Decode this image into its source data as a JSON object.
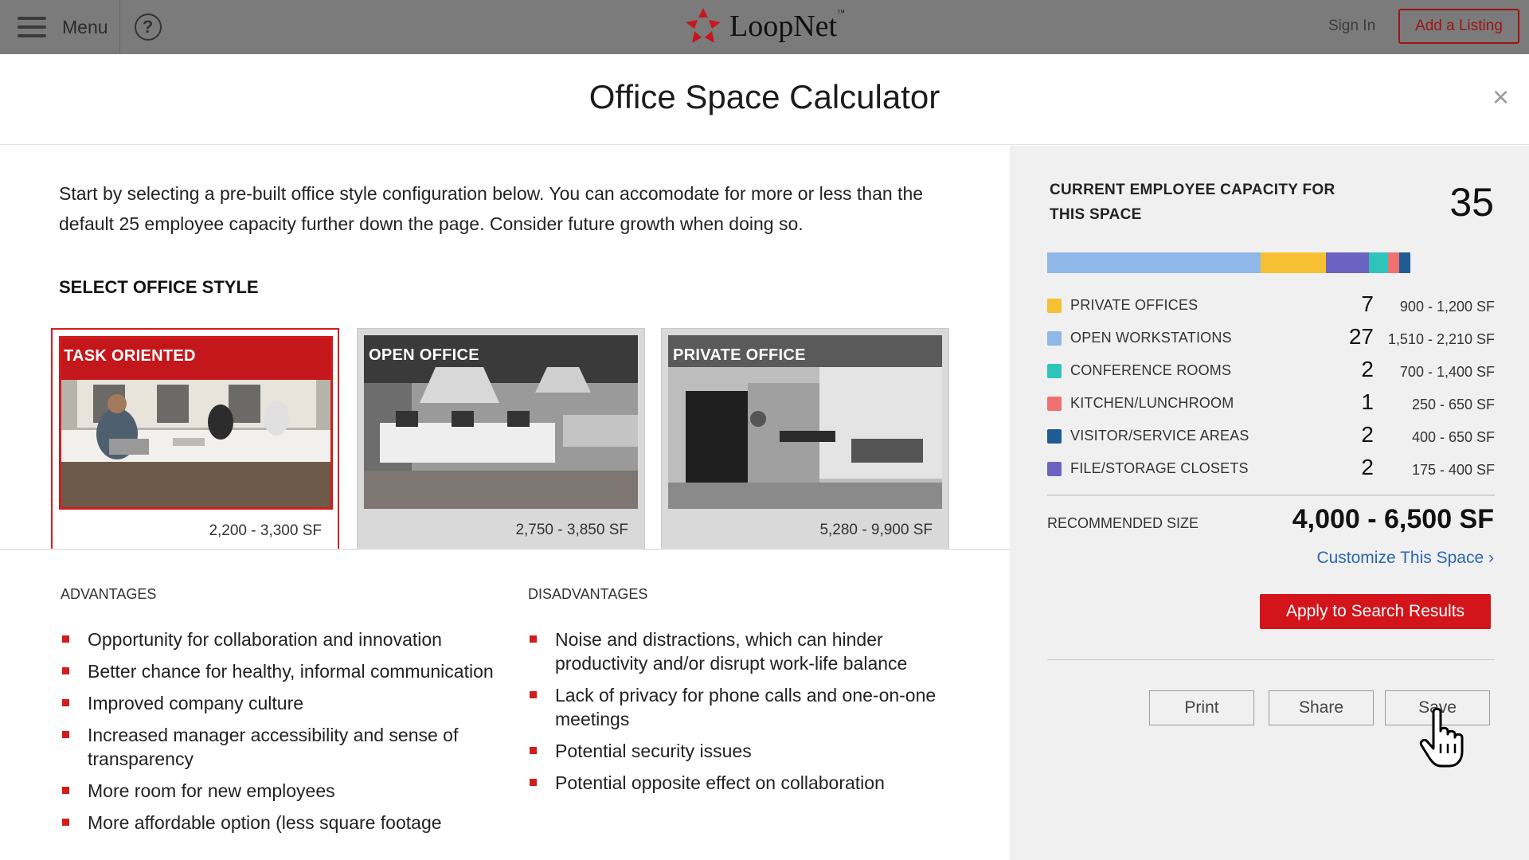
{
  "topbar": {
    "menu_label": "Menu",
    "help_icon": "question-circle-icon",
    "logo_text": "LoopNet",
    "logo_tm": "™",
    "logo_color": "#c8161d",
    "signin_label": "Sign In",
    "add_listing_label": "Add a Listing"
  },
  "modal": {
    "title": "Office Space Calculator",
    "close_icon": "close-icon",
    "close_glyph": "×"
  },
  "intro_text": "Start by selecting a pre-built office style configuration below. You can accomodate for more or less than the default 25 employee capacity further down the page. Consider future growth when doing so.",
  "select_style_title": "SELECT OFFICE STYLE",
  "office_styles": [
    {
      "label": "TASK ORIENTED",
      "size": "2,200 - 3,300 SF",
      "selected": true
    },
    {
      "label": "OPEN OFFICE",
      "size": "2,750 - 3,850 SF",
      "selected": false
    },
    {
      "label": "PRIVATE OFFICE",
      "size": "5,280 - 9,900 SF",
      "selected": false
    }
  ],
  "advantages": {
    "title": "ADVANTAGES",
    "items": [
      "Opportunity for collaboration and innovation",
      "Better chance for healthy, informal communication",
      "Improved company culture",
      "Increased manager accessibility and sense of transparency",
      "More room for new employees",
      "More affordable option (less square footage"
    ]
  },
  "disadvantages": {
    "title": "DISADVANTAGES",
    "items": [
      "Noise and distractions, which can hinder productivity and/or disrupt work-life balance",
      "Lack of privacy for phone calls and one-on-one meetings",
      "Potential security issues",
      "Potential opposite effect on collaboration"
    ]
  },
  "capacity": {
    "label": "CURRENT EMPLOYEE CAPACITY FOR THIS SPACE",
    "value": "35"
  },
  "categories": [
    {
      "name": "PRIVATE OFFICES",
      "count": "7",
      "range": "900 - 1,200 SF",
      "color": "#f5c033"
    },
    {
      "name": "OPEN WORKSTATIONS",
      "count": "27",
      "range": "1,510 - 2,210 SF",
      "color": "#8fb7e8"
    },
    {
      "name": "CONFERENCE ROOMS",
      "count": "2",
      "range": "700 - 1,400 SF",
      "color": "#2ec4bb"
    },
    {
      "name": "KITCHEN/LUNCHROOM",
      "count": "1",
      "range": "250 - 650 SF",
      "color": "#f07070"
    },
    {
      "name": "VISITOR/SERVICE AREAS",
      "count": "2",
      "range": "400 - 650 SF",
      "color": "#1f5c94"
    },
    {
      "name": "FILE/STORAGE CLOSETS",
      "count": "2",
      "range": "175 - 400 SF",
      "color": "#6a63c2"
    }
  ],
  "capacity_bar": [
    {
      "color": "#8fb7e8",
      "fraction": 0.477
    },
    {
      "color": "#f5c033",
      "fraction": 0.146
    },
    {
      "color": "#6a63c2",
      "fraction": 0.096
    },
    {
      "color": "#2ec4bb",
      "fraction": 0.043
    },
    {
      "color": "#f07070",
      "fraction": 0.025
    },
    {
      "color": "#1f5c94",
      "fraction": 0.025
    }
  ],
  "recommended": {
    "label": "RECOMMENDED SIZE",
    "value": "4,000 - 6,500 SF"
  },
  "customize_label": "Customize This Space",
  "customize_chevron": "›",
  "apply_label": "Apply to Search Results",
  "actions": {
    "print": "Print",
    "share": "Share",
    "save": "Save"
  }
}
